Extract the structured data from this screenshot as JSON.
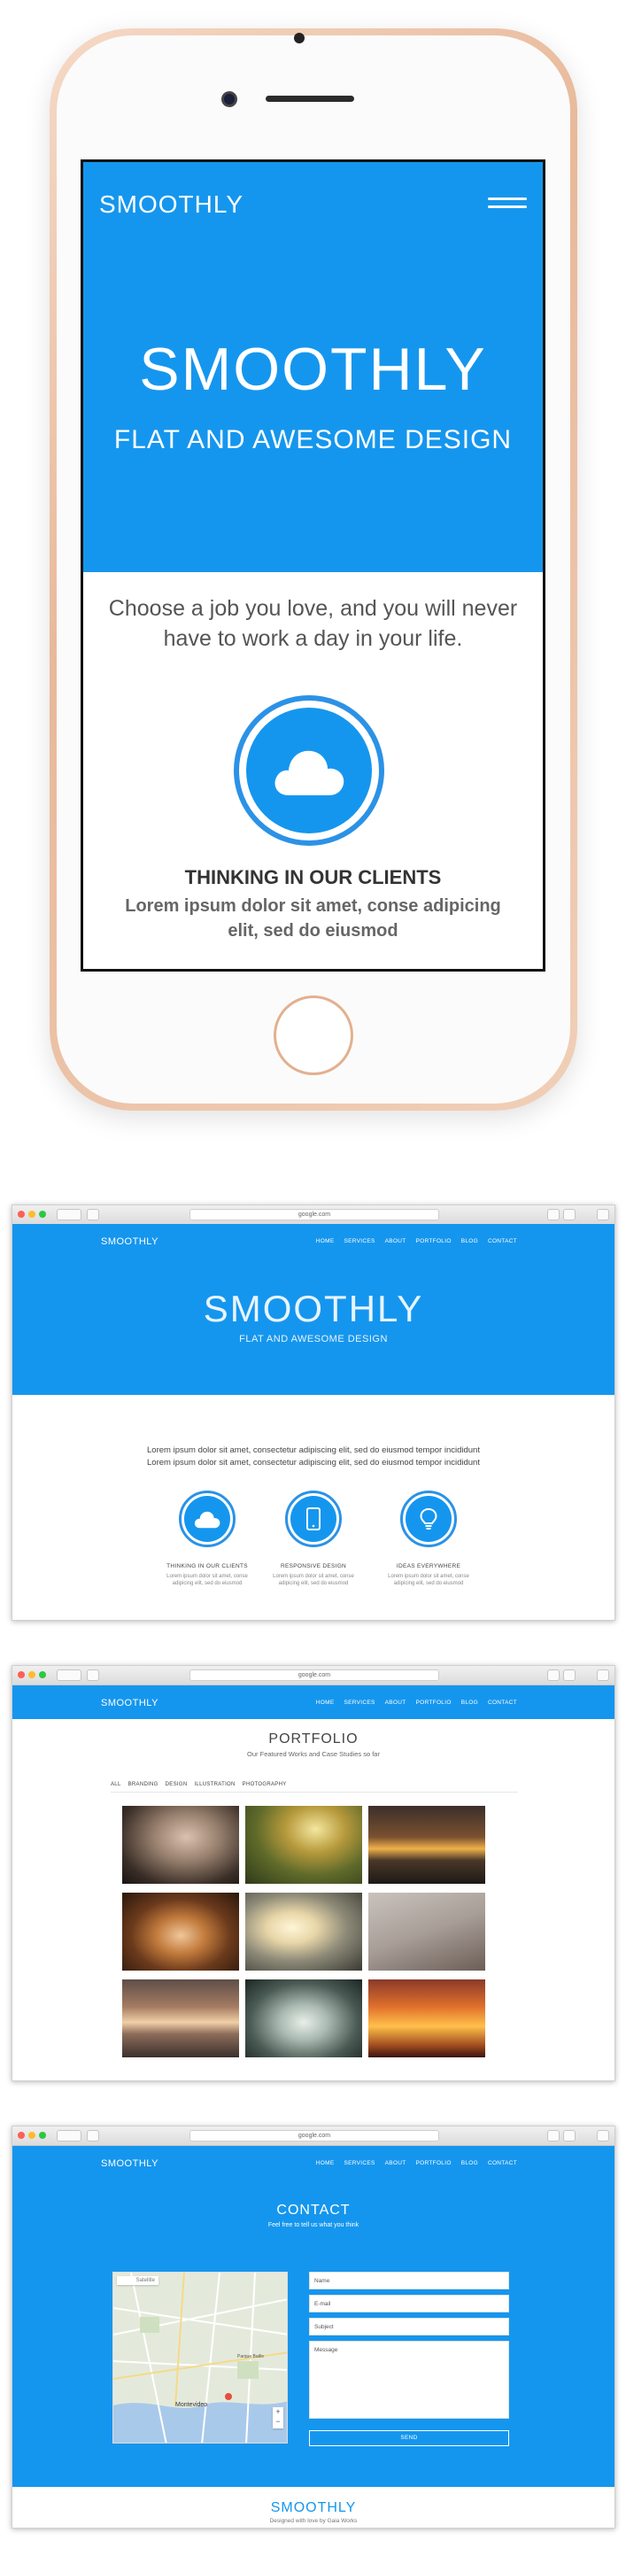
{
  "mobile": {
    "brand": "SMOOTHLY",
    "hero_title": "SMOOTHLY",
    "hero_subtitle": "FLAT AND AWESOME DESIGN",
    "quote": "Choose a job you love, and you will never have to work a day in your life.",
    "feature_icon": "cloud-icon",
    "feature_title": "THINKING IN OUR CLIENTS",
    "feature_text": "Lorem ipsum dolor sit amet, conse adipicing elit, sed do eiusmod",
    "accent": "#1596ee"
  },
  "browser": {
    "url": "google.com"
  },
  "nav": {
    "brand": "SMOOTHLY",
    "items": [
      "HOME",
      "SERVICES",
      "ABOUT",
      "PORTFOLIO",
      "BLOG",
      "CONTACT"
    ]
  },
  "home": {
    "hero_title": "SMOOTHLY",
    "hero_subtitle": "FLAT AND AWESOME DESIGN",
    "lead_line1": "Lorem ipsum dolor sit amet, consectetur adipiscing elit, sed do eiusmod tempor incididunt",
    "lead_line2": "Lorem ipsum dolor sit amet, consectetur adipiscing elit, sed do eiusmod tempor incididunt",
    "features": [
      {
        "icon": "cloud-icon",
        "title": "THINKING IN OUR CLIENTS",
        "text1": "Lorem ipsum dolor sit amet, conse",
        "text2": "adipicing elit, sed do eiusmod"
      },
      {
        "icon": "mobile-icon",
        "title": "RESPONSIVE DESIGN",
        "text1": "Lorem ipsum dolor sit amet, conse",
        "text2": "adipicing elit, sed do eiusmod"
      },
      {
        "icon": "lightbulb-icon",
        "title": "IDEAS EVERYWHERE",
        "text1": "Lorem ipsum dolor sit amet, conse",
        "text2": "adipicing elit, sed do eiusmod"
      }
    ]
  },
  "portfolio": {
    "title": "PORTFOLIO",
    "subtitle": "Our Featured Works and Case Studies so far",
    "filters": [
      "ALL",
      "BRANDING",
      "DESIGN",
      "ILLUSTRATION",
      "PHOTOGRAPHY"
    ],
    "thumbnails": [
      "portrait-woman",
      "autumn-forest",
      "sunset-lake",
      "hands-cards",
      "silhouette-sky",
      "bare-branches",
      "sea-sunset",
      "woman-water",
      "jumping-silhouettes"
    ]
  },
  "contact": {
    "title": "CONTACT",
    "subtitle": "Feel free to tell us what you think",
    "map_tabs": [
      "Map",
      "Satellite"
    ],
    "map_city": "Montevideo",
    "map_area": "Parque Batlle",
    "fields": {
      "name": "Name",
      "email": "E-mail",
      "subject": "Subject",
      "message": "Message"
    },
    "send": "SEND"
  },
  "footer": {
    "brand": "SMOOTHLY",
    "credit": "Designed with love by Gaia Works"
  }
}
